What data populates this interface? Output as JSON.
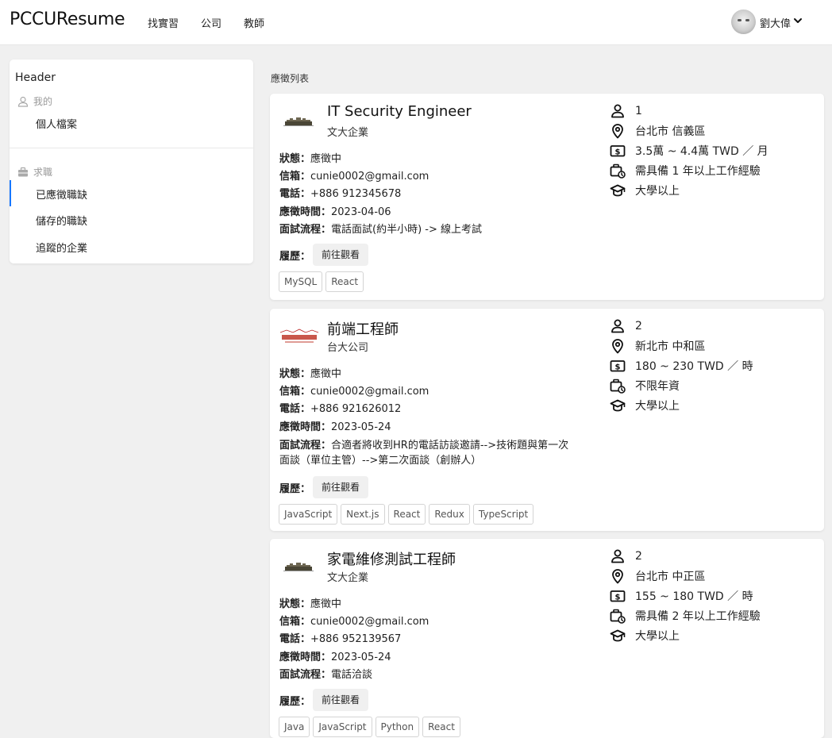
{
  "app": {
    "brand": "PCCUResume"
  },
  "nav": {
    "links": [
      "找實習",
      "公司",
      "教師"
    ]
  },
  "user": {
    "name": "劉大偉"
  },
  "sidebar": {
    "header": "Header",
    "group_mine": "我的",
    "profile": "個人檔案",
    "group_jobs": "求職",
    "applied": "已應徵職缺",
    "saved": "儲存的職缺",
    "followed": "追蹤的企業"
  },
  "main": {
    "section_title": "應徵列表"
  },
  "labels": {
    "status": "狀態：",
    "email": "信箱：",
    "phone": "電話：",
    "applied_at": "應徵時間：",
    "process": "面試流程：",
    "resume": "履歷：",
    "view": "前往觀看"
  },
  "jobs": [
    {
      "title": "IT Security Engineer",
      "company": "文大企業",
      "status": "應徵中",
      "email": "cunie0002@gmail.com",
      "phone": "+886 912345678",
      "applied_at": "2023-04-06",
      "process": "電話面試(約半小時) -> 線上考試",
      "tags": [
        "MySQL",
        "React"
      ],
      "openings": "1",
      "location": "台北市 信義區",
      "salary": "3.5萬 ~ 4.4萬 TWD ／ 月",
      "experience": "需具備 1 年以上工作經驗",
      "education": "大學以上"
    },
    {
      "title": "前端工程師",
      "company": "台大公司",
      "status": "應徵中",
      "email": "cunie0002@gmail.com",
      "phone": "+886 921626012",
      "applied_at": "2023-05-24",
      "process_line1": "合適者將收到HR的電話訪談邀請-->技術題與第一次",
      "process_line2": "面談（單位主管）-->第二次面談（創辦人）",
      "tags": [
        "JavaScript",
        "Next.js",
        "React",
        "Redux",
        "TypeScript"
      ],
      "openings": "2",
      "location": "新北市 中和區",
      "salary": "180 ~ 230 TWD ／ 時",
      "experience": "不限年資",
      "education": "大學以上"
    },
    {
      "title": "家電維修測試工程師",
      "company": "文大企業",
      "status": "應徵中",
      "email": "cunie0002@gmail.com",
      "phone": "+886 952139567",
      "applied_at": "2023-05-24",
      "process": "電話洽談",
      "tags": [
        "Java",
        "JavaScript",
        "Python",
        "React"
      ],
      "openings": "2",
      "location": "台北市 中正區",
      "salary": "155 ~ 180 TWD ／ 時",
      "experience": "需具備 2 年以上工作經驗",
      "education": "大學以上"
    }
  ]
}
